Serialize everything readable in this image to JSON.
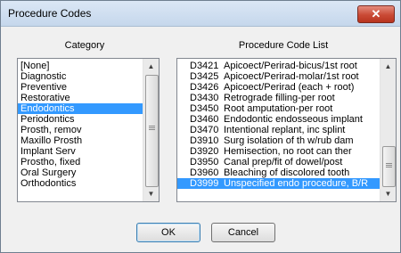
{
  "window": {
    "title": "Procedure Codes",
    "close_glyph": "✕"
  },
  "category": {
    "header": "Category",
    "items": [
      "[None]",
      "Diagnostic",
      "Preventive",
      "Restorative",
      "Endodontics",
      "Periodontics",
      "Prosth, remov",
      "Maxillo Prosth",
      "Implant Serv",
      "Prostho, fixed",
      "Oral Surgery",
      "Orthodontics"
    ],
    "selected_index": 4
  },
  "procedures": {
    "header": "Procedure Code List",
    "rows": [
      {
        "code": "D3421",
        "description": "Apicoect/Perirad-bicus/1st root"
      },
      {
        "code": "D3425",
        "description": "Apicoect/Perirad-molar/1st root"
      },
      {
        "code": "D3426",
        "description": "Apicoect/Perirad (each + root)"
      },
      {
        "code": "D3430",
        "description": "Retrograde filling-per root"
      },
      {
        "code": "D3450",
        "description": "Root amputation-per root"
      },
      {
        "code": "D3460",
        "description": "Endodontic endosseous implant"
      },
      {
        "code": "D3470",
        "description": "Intentional replant, inc splint"
      },
      {
        "code": "D3910",
        "description": "Surg isolation of th w/rub dam"
      },
      {
        "code": "D3920",
        "description": "Hemisection, no root can ther"
      },
      {
        "code": "D3950",
        "description": "Canal prep/fit of dowel/post"
      },
      {
        "code": "D3960",
        "description": "Bleaching of discolored tooth"
      },
      {
        "code": "D3999",
        "description": "Unspecified endo procedure, B/R"
      }
    ],
    "selected_index": 11
  },
  "buttons": {
    "ok": "OK",
    "cancel": "Cancel"
  },
  "colors": {
    "selection": "#3399ff",
    "close": "#c94a35"
  }
}
